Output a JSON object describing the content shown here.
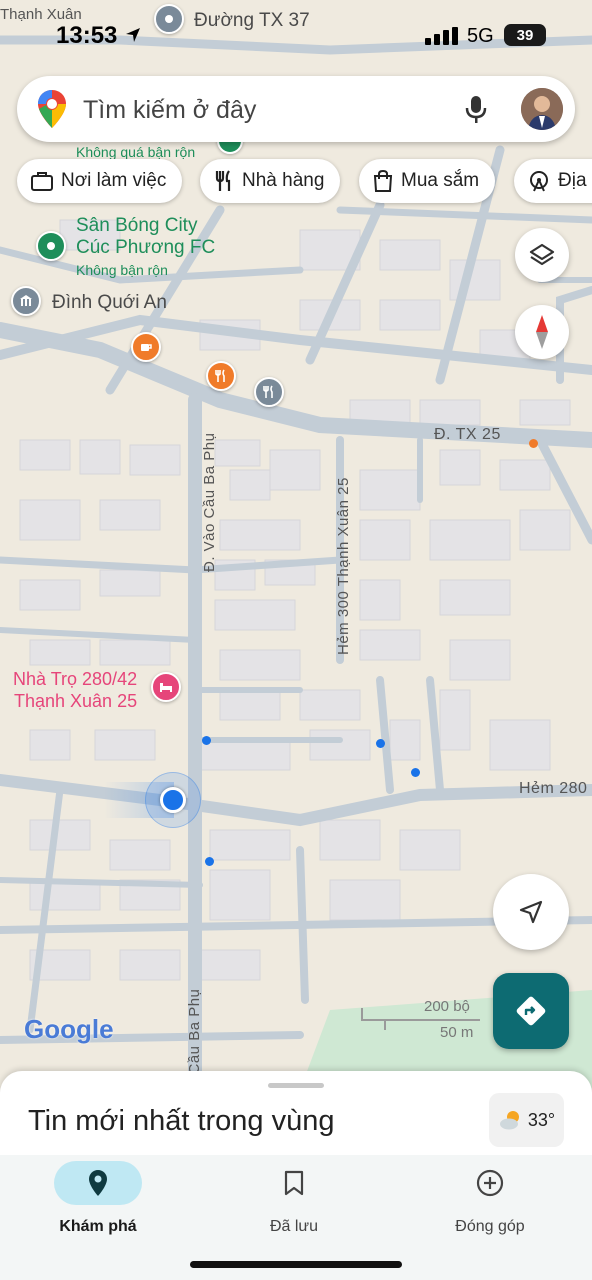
{
  "status_bar": {
    "time": "13:53",
    "network": "5G",
    "battery": "39"
  },
  "search": {
    "placeholder": "Tìm kiếm ở đây"
  },
  "chips": [
    {
      "label": "Nơi làm việc",
      "icon": "briefcase-icon"
    },
    {
      "label": "Nhà hàng",
      "icon": "fork-knife-icon"
    },
    {
      "label": "Mua sắm",
      "icon": "shopping-bag-icon"
    },
    {
      "label": "Địa",
      "icon": "ferris-wheel-icon"
    }
  ],
  "map": {
    "labels": {
      "duong_tx37": "Đường TX 37",
      "thanh_xuan_top": "Thạnh Xuân",
      "khong_qua_ban_ron": "Không quá bận rộn",
      "san_bong_line1": "Sân Bóng City",
      "san_bong_line2": "Cúc Phương FC",
      "san_bong_busy": "Không bận rộn",
      "dinh_quoi_an": "Đình Quới An",
      "d_tx25": "Đ. TX 25",
      "vao_cau_ba_phu": "Đ. Vào Cầu Ba Phụ",
      "hem_300": "Hẻm 300 Thạnh Xuân 25",
      "nha_tro_line1": "Nhà Trọ 280/42",
      "nha_tro_line2": "Thạnh Xuân 25",
      "hem_280": "Hẻm 280",
      "cau_ba_phu_bottom": "ò Cầu Ba Phụ",
      "google_logo": "Google",
      "scale_ft": "200 bộ",
      "scale_m": "50 m"
    }
  },
  "sheet": {
    "title": "Tin mới nhất trong vùng",
    "weather_temp": "33°"
  },
  "nav": [
    {
      "label": "Khám phá",
      "icon": "location-pin-icon",
      "active": true
    },
    {
      "label": "Đã lưu",
      "icon": "bookmark-icon",
      "active": false
    },
    {
      "label": "Đóng góp",
      "icon": "add-circle-icon",
      "active": false
    }
  ],
  "colors": {
    "accent_teal": "#0d6b72",
    "nav_active": "#bfe8f3",
    "poi_green": "#1e8e5a",
    "poi_orange": "#f07b2a",
    "poi_pink": "#e6457a",
    "location_blue": "#1a73e8"
  }
}
